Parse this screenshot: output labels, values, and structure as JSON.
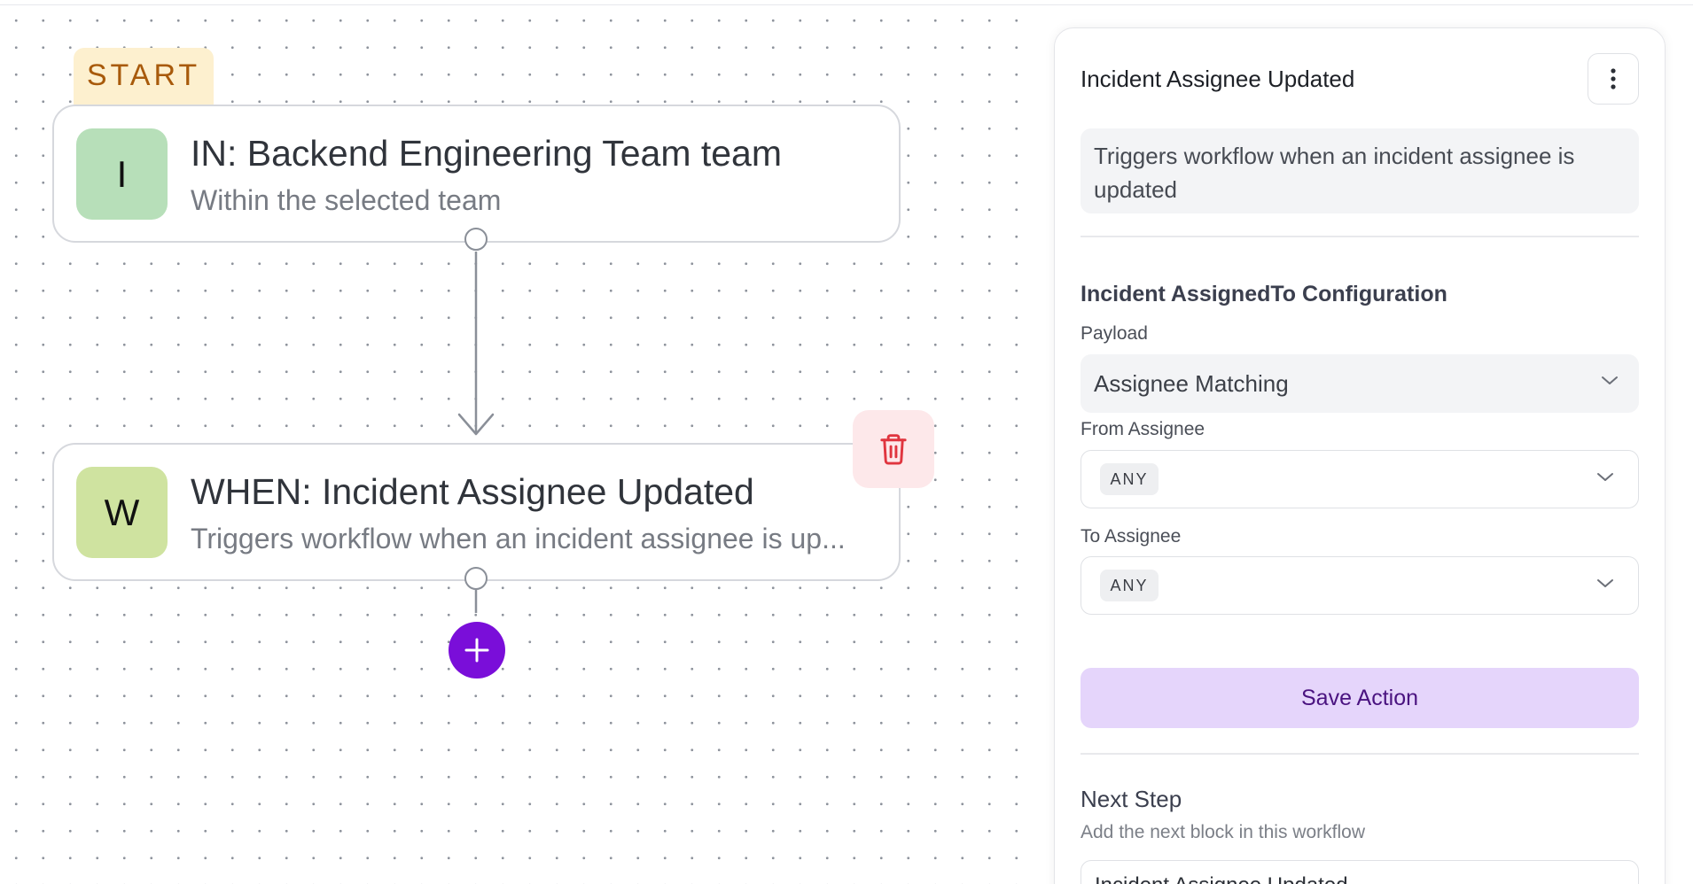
{
  "canvas": {
    "start_badge": "START",
    "in_node": {
      "letter": "I",
      "title": "IN: Backend Engineering Team team",
      "subtitle": "Within the selected team",
      "color": "#b7dfb9"
    },
    "when_node": {
      "letter": "W",
      "title": "WHEN: Incident Assignee Updated",
      "subtitle": "Triggers workflow when an incident assignee is up...",
      "color": "#cfe3a0"
    },
    "delete_icon": "trash-icon",
    "add_icon": "plus-icon",
    "accent_color": "#7a0ed9"
  },
  "panel": {
    "title": "Incident Assignee Updated",
    "menu_icon": "kebab-icon",
    "description": "Triggers workflow when an incident assignee is updated",
    "config_heading": "Incident AssignedTo Configuration",
    "payload": {
      "label": "Payload",
      "value": "Assignee Matching"
    },
    "from_assignee": {
      "label": "From Assignee",
      "chip": "ANY"
    },
    "to_assignee": {
      "label": "To Assignee",
      "chip": "ANY"
    },
    "save_label": "Save Action",
    "next_step": {
      "heading": "Next Step",
      "subtitle": "Add the next block in this workflow",
      "value": "Incident Assignee Updated"
    }
  }
}
